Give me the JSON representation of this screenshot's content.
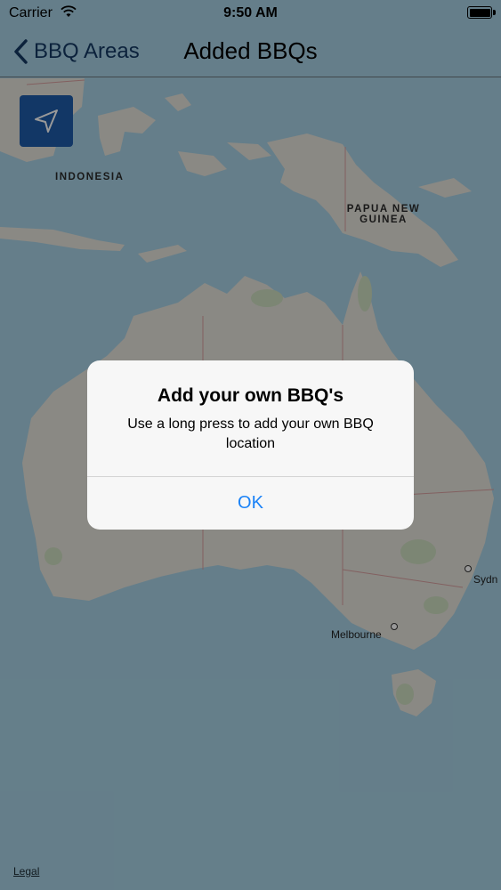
{
  "status_bar": {
    "carrier": "Carrier",
    "time": "9:50 AM",
    "wifi_icon": "wifi-icon",
    "battery_icon": "battery-full-icon"
  },
  "nav_bar": {
    "back_label": "BBQ Areas",
    "title": "Added BBQs"
  },
  "map": {
    "locate_button_icon": "location-arrow-icon",
    "labels": {
      "indonesia": "INDONESIA",
      "png_line1": "PAPUA NEW",
      "png_line2": "GUINEA",
      "melbourne": "Melbourne",
      "sydney": "Sydn"
    },
    "legal": "Legal",
    "colors": {
      "land": "#e7e4dc",
      "water": "#a8d2e6",
      "accent": "#1e5cab"
    }
  },
  "alert": {
    "title": "Add your own BBQ's",
    "message": "Use a long press to add your own BBQ location",
    "ok_label": "OK"
  }
}
